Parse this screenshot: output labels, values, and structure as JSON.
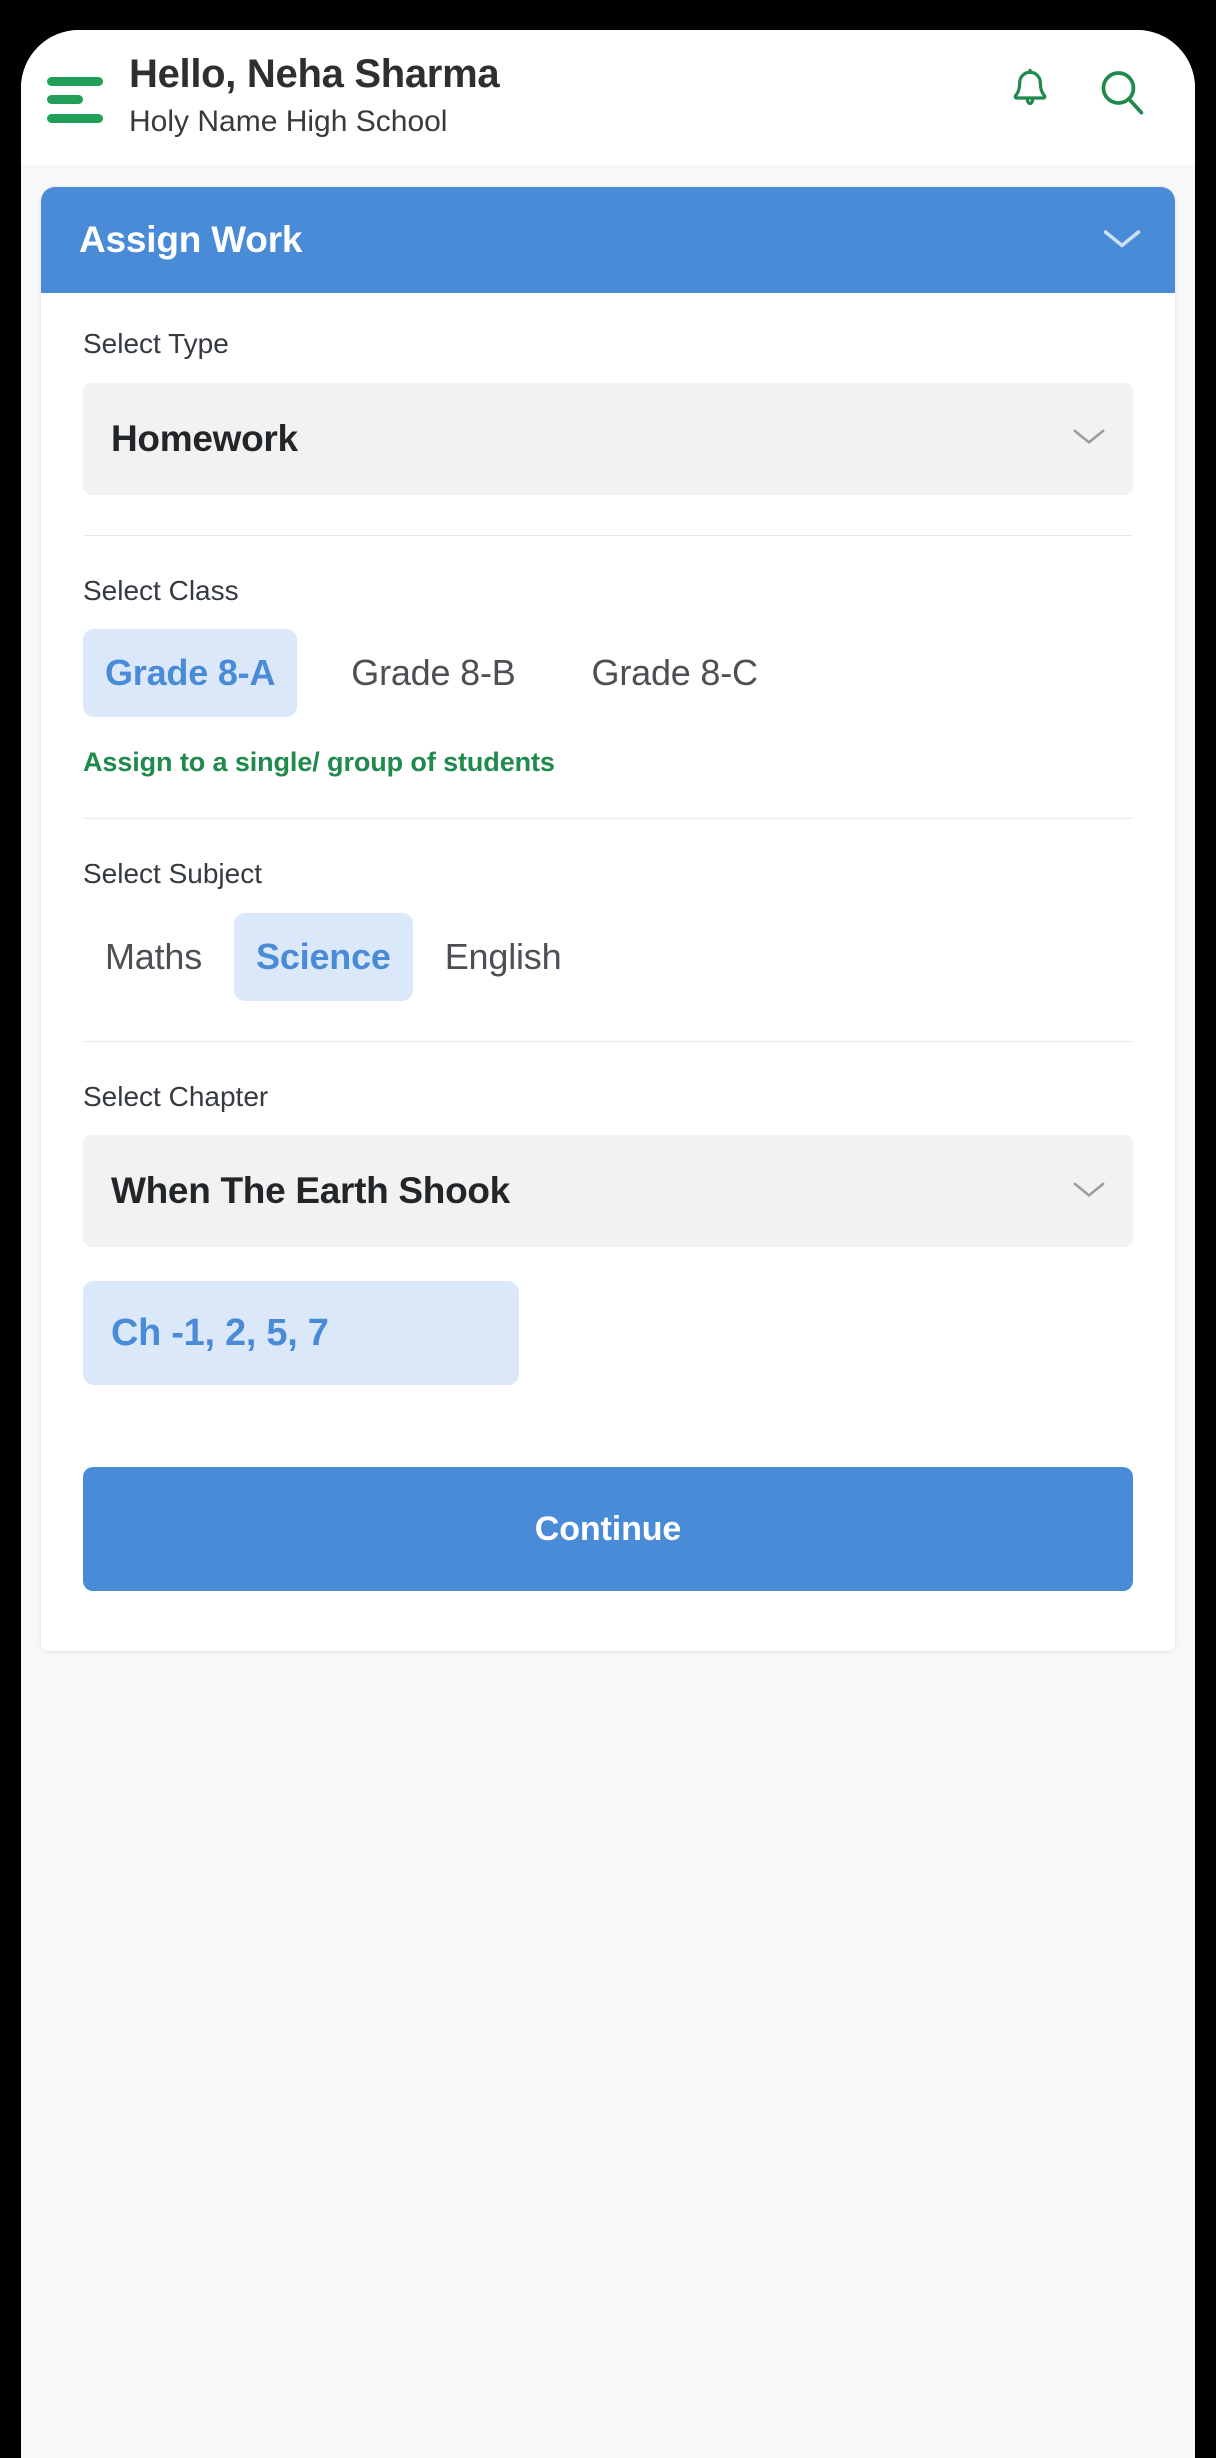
{
  "theme": {
    "green": "#1f8a4c",
    "hamburger_green": "#22a05a",
    "blue": "#4a8bd8",
    "pill_blue_bg": "#dbe8fa",
    "field_grey": "#f2f2f3",
    "page_bg": "#f7f8fa"
  },
  "header": {
    "menu_icon": "hamburger-menu-icon",
    "greeting": "Hello, Neha Sharma",
    "school": "Holy Name High School",
    "notification_icon": "bell-icon",
    "search_icon": "search-icon"
  },
  "card": {
    "title": "Assign Work",
    "collapse_icon": "chevron-down-icon",
    "type_section": {
      "label": "Select Type",
      "selected": "Homework",
      "dropdown_icon": "chevron-down-icon",
      "options": [
        "Homework"
      ]
    },
    "class_section": {
      "label": "Select Class",
      "options": [
        "Grade 8-A",
        "Grade 8-B",
        "Grade 8-C"
      ],
      "selected": "Grade 8-A",
      "link": "Assign to a single/ group of students"
    },
    "subject_section": {
      "label": "Select Subject",
      "options": [
        "Maths",
        "Science",
        "English"
      ],
      "selected": "Science"
    },
    "chapter_section": {
      "label": "Select Chapter",
      "selected": "When The Earth Shook",
      "dropdown_icon": "chevron-down-icon",
      "options": [
        "When The Earth Shook"
      ],
      "tag_prefix": "Ch - ",
      "tag_numbers": "1, 2, 5, 7"
    },
    "primary_action": "Continue"
  }
}
